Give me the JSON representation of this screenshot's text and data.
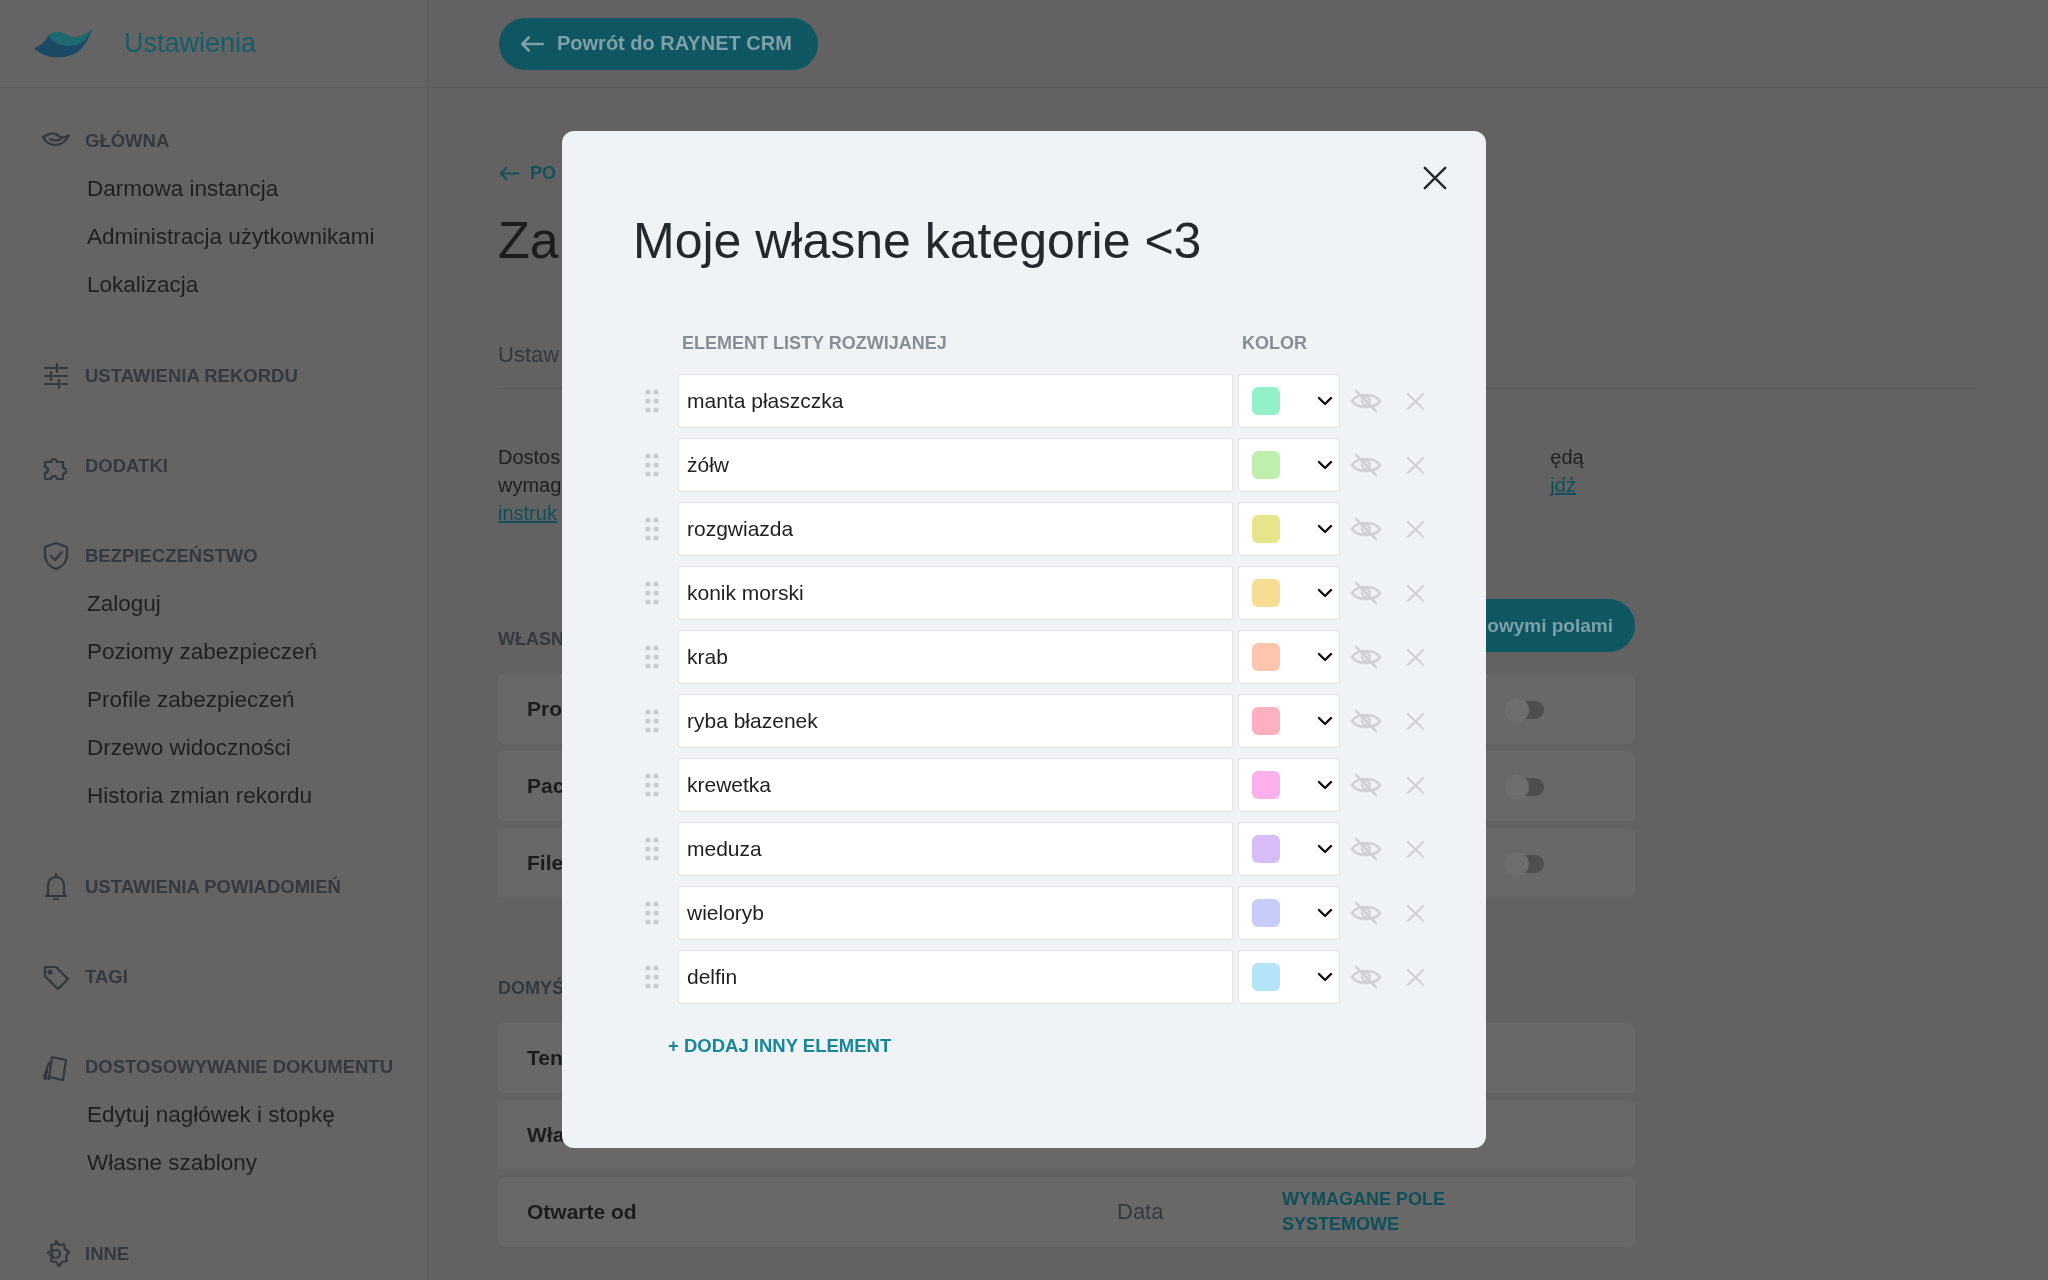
{
  "sidebar": {
    "title": "Ustawienia",
    "sections": [
      {
        "title": "GŁÓWNA",
        "items": [
          "Darmowa instancja",
          "Administracja użytkownikami",
          "Lokalizacja"
        ]
      },
      {
        "title": "USTAWIENIA REKORDU"
      },
      {
        "title": "DODATKI"
      },
      {
        "title": "BEZPIECZEŃSTWO",
        "items": [
          "Zaloguj",
          "Poziomy zabezpieczeń",
          "Profile zabezpieczeń",
          "Drzewo widoczności",
          "Historia zmian rekordu"
        ]
      },
      {
        "title": "USTAWIENIA POWIADOMIEŃ"
      },
      {
        "title": "TAGI"
      },
      {
        "title": "DOSTOSOWYWANIE DOKUMENTU",
        "items": [
          "Edytuj nagłówek i stopkę",
          "Własne szablony"
        ]
      },
      {
        "title": "INNE"
      }
    ]
  },
  "header": {
    "back_button": "Powrót do RAYNET CRM"
  },
  "page": {
    "back_link": "PO",
    "title": "Za",
    "tab": "Ustaw",
    "description": {
      "left_lines": [
        "Dostos",
        "wymag"
      ],
      "left_link": "instruk",
      "right_line": "ędą",
      "right_link": "jdź"
    },
    "custom_section": {
      "title": "WŁASN",
      "button": "owymi polami",
      "rows": [
        {
          "label": "Pro",
          "on": false
        },
        {
          "label": "Pac",
          "on": false
        },
        {
          "label": "File",
          "on": false
        }
      ]
    },
    "default_section": {
      "title": "DOMYŚ",
      "rows": [
        {
          "label": "Ten"
        },
        {
          "label": "Wła"
        },
        {
          "label": "Otwarte od",
          "type": "Data",
          "status": "WYMAGANE POLE SYSTEMOWE"
        }
      ]
    }
  },
  "dialog": {
    "title": "Moje własne kategorie <3",
    "columns": [
      "ELEMENT LISTY ROZWIJANEJ",
      "KOLOR"
    ],
    "items": [
      {
        "label": "manta płaszczka",
        "color": "#94f0c8"
      },
      {
        "label": "żółw",
        "color": "#c0eeac"
      },
      {
        "label": "rozgwiazda",
        "color": "#e8e48c"
      },
      {
        "label": "konik morski",
        "color": "#f7dc94"
      },
      {
        "label": "krab",
        "color": "#fdc6ac"
      },
      {
        "label": "ryba błazenek",
        "color": "#fdb0c0"
      },
      {
        "label": "krewetka",
        "color": "#fbb0ec"
      },
      {
        "label": "meduza",
        "color": "#d8bcf8"
      },
      {
        "label": "wieloryb",
        "color": "#c8ccfa"
      },
      {
        "label": "delfin",
        "color": "#b4e4f8"
      }
    ],
    "add_link": "+ DODAJ INNY ELEMENT"
  }
}
